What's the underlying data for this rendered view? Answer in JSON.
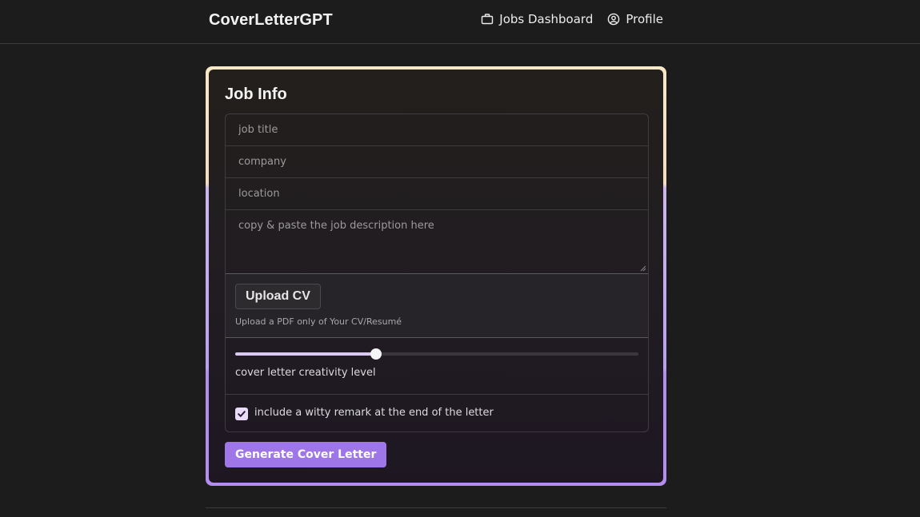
{
  "header": {
    "brand": "CoverLetterGPT",
    "nav": [
      {
        "label": "Jobs Dashboard",
        "icon": "briefcase-icon"
      },
      {
        "label": "Profile",
        "icon": "user-circle-icon"
      }
    ]
  },
  "form": {
    "title": "Job Info",
    "job_title_placeholder": "job title",
    "company_placeholder": "company",
    "location_placeholder": "location",
    "description_placeholder": "copy & paste the job description here",
    "upload_button_label": "Upload CV",
    "upload_hint": "Upload a PDF only of Your CV/Resumé",
    "creativity_slider": {
      "label": "cover letter creativity level",
      "value": 0.35
    },
    "witty_remark_checkbox": {
      "label": "include a witty remark at the end of the letter",
      "checked": true
    },
    "submit_label": "Generate Cover Letter"
  },
  "colors": {
    "accent": "#9f76e8",
    "border_top": "#f9e8c6",
    "border_bottom": "#b38df0",
    "background": "#1c1c1c"
  }
}
